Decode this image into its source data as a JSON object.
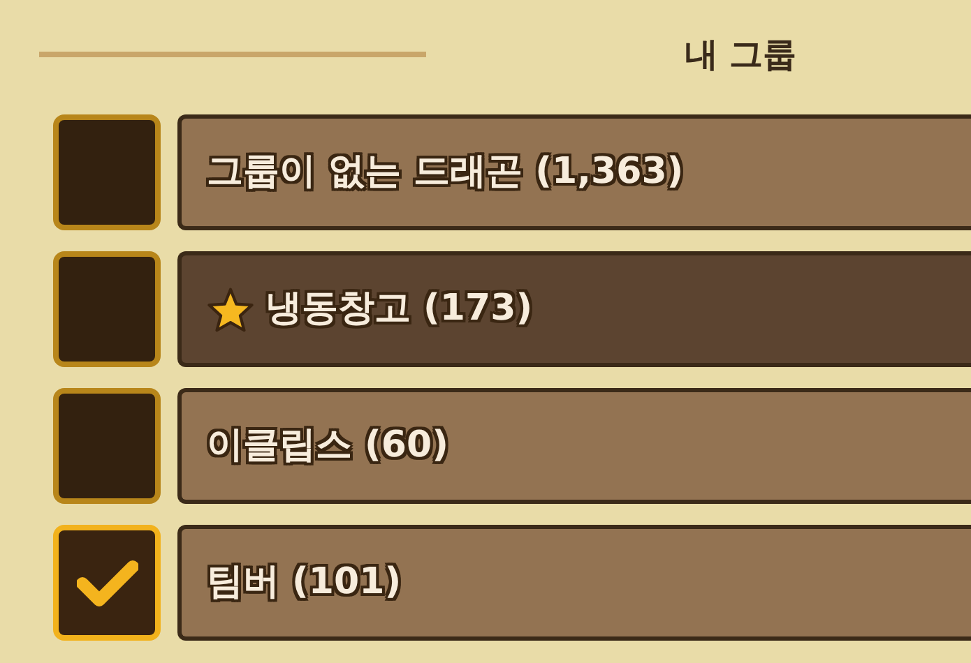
{
  "title": "내 그룹",
  "groups": [
    {
      "label": "그룹이 없는 드래곤 (1,363)",
      "starred": false,
      "checked": false
    },
    {
      "label": "냉동창고 (173)",
      "starred": true,
      "checked": false
    },
    {
      "label": "이클립스 (60)",
      "starred": false,
      "checked": false
    },
    {
      "label": "팀버 (101)",
      "starred": false,
      "checked": true
    }
  ]
}
